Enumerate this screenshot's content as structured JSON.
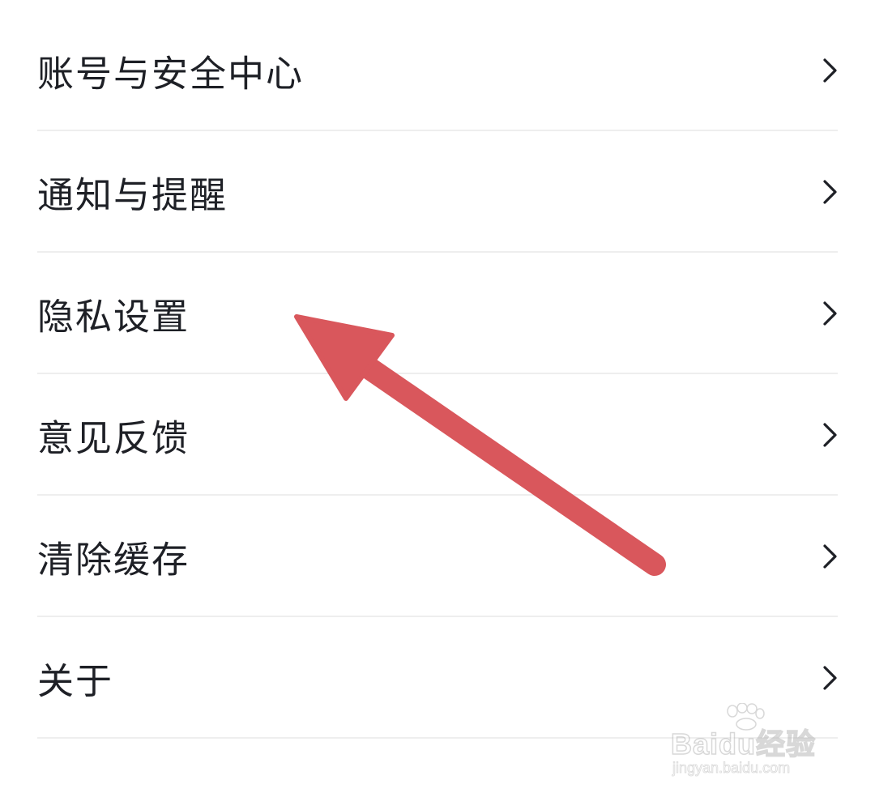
{
  "menu": {
    "items": [
      {
        "label": "账号与安全中心",
        "icon": "chevron-right-icon"
      },
      {
        "label": "通知与提醒",
        "icon": "chevron-right-icon"
      },
      {
        "label": "隐私设置",
        "icon": "chevron-right-icon"
      },
      {
        "label": "意见反馈",
        "icon": "chevron-right-icon"
      },
      {
        "label": "清除缓存",
        "icon": "chevron-right-icon"
      },
      {
        "label": "关于",
        "icon": "chevron-right-icon"
      }
    ]
  },
  "annotation": {
    "icon": "red-arrow-icon",
    "color": "#d9575c",
    "points_to": "隐私设置"
  },
  "watermark": {
    "logo_text": "Baidu经验",
    "url": "jingyan.baidu.com"
  },
  "colors": {
    "text": "#1e2026",
    "divider": "#eeeeee",
    "background": "#ffffff"
  }
}
